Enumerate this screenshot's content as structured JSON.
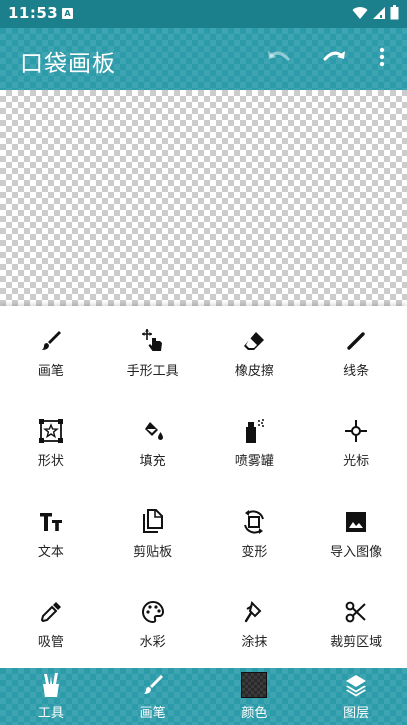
{
  "status_bar": {
    "time": "11:53",
    "notification_badge": "A",
    "icons": [
      "wifi-icon",
      "signal-icon",
      "battery-icon"
    ]
  },
  "app_bar": {
    "title": "口袋画板",
    "actions": [
      "undo-icon",
      "redo-icon",
      "more-vert-icon"
    ]
  },
  "tools": [
    {
      "label": "画笔",
      "icon": "brush-icon"
    },
    {
      "label": "手形工具",
      "icon": "hand-move-icon"
    },
    {
      "label": "橡皮擦",
      "icon": "eraser-icon"
    },
    {
      "label": "线条",
      "icon": "line-icon"
    },
    {
      "label": "形状",
      "icon": "shape-icon"
    },
    {
      "label": "填充",
      "icon": "fill-bucket-icon"
    },
    {
      "label": "喷雾罐",
      "icon": "spray-can-icon"
    },
    {
      "label": "光标",
      "icon": "cursor-icon"
    },
    {
      "label": "文本",
      "icon": "text-icon"
    },
    {
      "label": "剪贴板",
      "icon": "clipboard-icon"
    },
    {
      "label": "变形",
      "icon": "transform-icon"
    },
    {
      "label": "导入图像",
      "icon": "image-icon"
    },
    {
      "label": "吸管",
      "icon": "eyedropper-icon"
    },
    {
      "label": "水彩",
      "icon": "palette-icon"
    },
    {
      "label": "涂抹",
      "icon": "smudge-icon"
    },
    {
      "label": "裁剪区域",
      "icon": "scissors-icon"
    }
  ],
  "bottom_nav": [
    {
      "label": "工具",
      "icon": "tools-icon"
    },
    {
      "label": "画笔",
      "icon": "brush-icon"
    },
    {
      "label": "颜色",
      "icon": "color-swatch"
    },
    {
      "label": "图层",
      "icon": "layers-icon"
    }
  ],
  "colors": {
    "status_bar": "#1c7f8c",
    "app_bar": "#2c9baa",
    "current_color": "#2a2a2a"
  }
}
